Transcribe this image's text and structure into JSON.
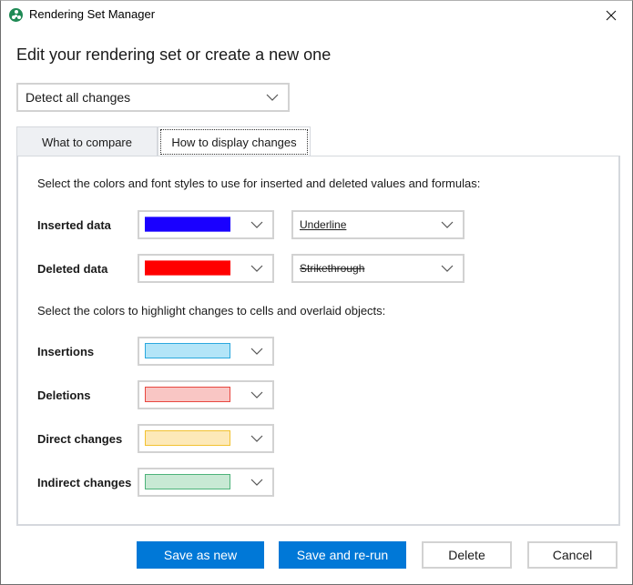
{
  "window": {
    "title": "Rendering Set Manager",
    "app_icon": "app-logo-icon",
    "close_icon": "close-icon"
  },
  "heading": "Edit your rendering set or create a new one",
  "preset": {
    "selected": "Detect all changes"
  },
  "tabs": [
    {
      "label": "What to compare",
      "active": false
    },
    {
      "label": "How to display changes",
      "active": true
    }
  ],
  "panel": {
    "font_section_desc": "Select the colors and font styles to use for inserted and deleted values and formulas:",
    "font_rows": [
      {
        "label": "Inserted data",
        "color": "#1a00ff",
        "font_style": "Underline"
      },
      {
        "label": "Deleted data",
        "color": "#ff0000",
        "font_style": "Strikethrough"
      }
    ],
    "highlight_section_desc": "Select the colors to highlight changes to cells and overlaid objects:",
    "highlight_rows": [
      {
        "label": "Insertions",
        "fill": "#b3e5f8",
        "border": "#2aa8de"
      },
      {
        "label": "Deletions",
        "fill": "#f9c6c4",
        "border": "#e8473f"
      },
      {
        "label": "Direct changes",
        "fill": "#fde9b8",
        "border": "#f2c230"
      },
      {
        "label": "Indirect changes",
        "fill": "#c8e9d4",
        "border": "#4db37a"
      }
    ]
  },
  "buttons": {
    "save_as_new": "Save as new",
    "save_and_rerun": "Save and re-run",
    "delete": "Delete",
    "cancel": "Cancel"
  },
  "colors": {
    "accent": "#0078d7"
  }
}
